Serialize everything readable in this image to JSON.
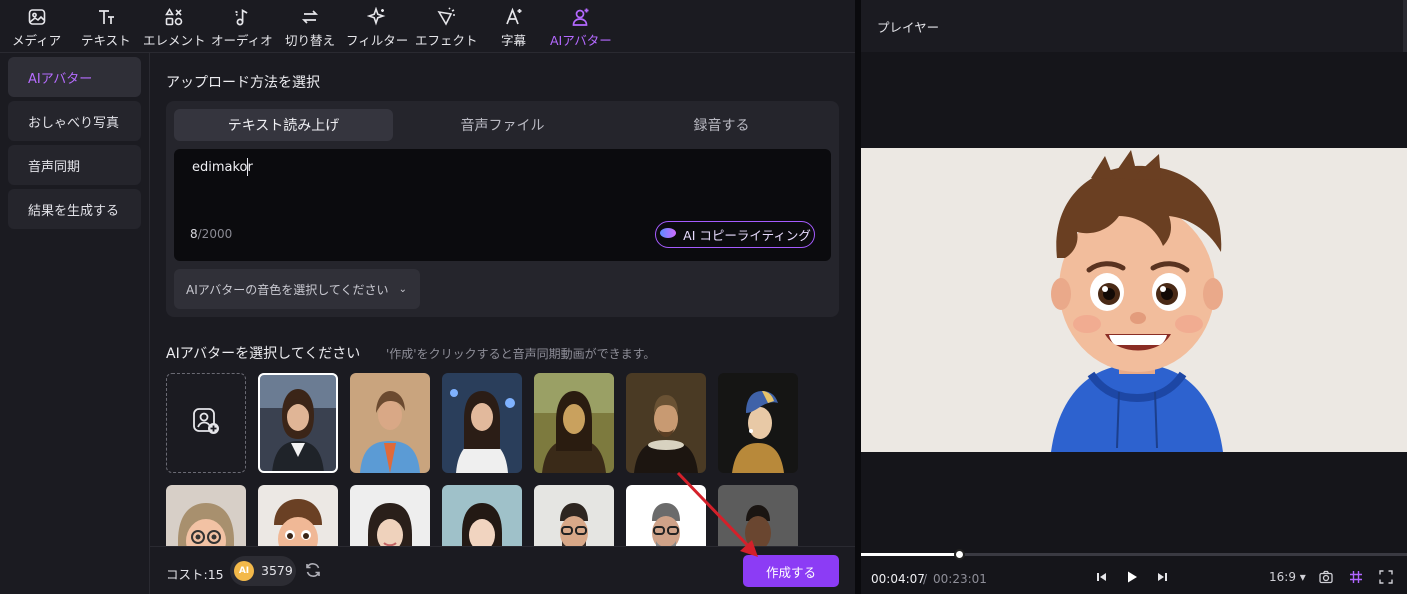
{
  "toolbar": {
    "items": [
      {
        "label": "メディア",
        "icon": "media-icon"
      },
      {
        "label": "テキスト",
        "icon": "text-icon"
      },
      {
        "label": "エレメント",
        "icon": "element-icon"
      },
      {
        "label": "オーディオ",
        "icon": "audio-icon"
      },
      {
        "label": "切り替え",
        "icon": "transition-icon"
      },
      {
        "label": "フィルター",
        "icon": "filter-icon"
      },
      {
        "label": "エフェクト",
        "icon": "effect-icon"
      },
      {
        "label": "字幕",
        "icon": "subtitle-icon"
      },
      {
        "label": "AIアバター",
        "icon": "ai-avatar-icon",
        "active": true
      }
    ]
  },
  "sidebar": {
    "items": [
      {
        "label": "AIアバター",
        "active": true
      },
      {
        "label": "おしゃべり写真"
      },
      {
        "label": "音声同期"
      },
      {
        "label": "結果を生成する"
      }
    ]
  },
  "upload": {
    "title": "アップロード方法を選択",
    "tabs": [
      {
        "label": "テキスト読み上げ",
        "active": true
      },
      {
        "label": "音声ファイル"
      },
      {
        "label": "録音する"
      }
    ],
    "text_value": "edimakor",
    "char_current": "8",
    "char_max": "/2000",
    "ai_copy_label": "AI コピーライティング",
    "voice_select_label": "AIアバターの音色を選択してください"
  },
  "avatars": {
    "heading": "AIアバターを選択してください",
    "hint": "'作成'をクリックすると音声同期動画ができます。",
    "items": [
      {
        "name": "woman-news-anchor",
        "selected": true
      },
      {
        "name": "woman-short-hair-blue-blazer"
      },
      {
        "name": "woman-long-hair-city"
      },
      {
        "name": "mona-lisa-painting"
      },
      {
        "name": "shakespeare-portrait"
      },
      {
        "name": "girl-pearl-earring-painting"
      },
      {
        "name": "cartoon-woman-glasses"
      },
      {
        "name": "cartoon-boy"
      },
      {
        "name": "asian-woman-white-bg"
      },
      {
        "name": "asian-woman-blue-bg"
      },
      {
        "name": "man-glasses-beard"
      },
      {
        "name": "man-glasses-suit"
      },
      {
        "name": "man-dark-suit"
      }
    ]
  },
  "footer": {
    "cost_label": "コスト:15",
    "credit_coin": "AI",
    "credits": "3579",
    "create_label": "作成する"
  },
  "player": {
    "title": "プレイヤー",
    "time_current": "00:04:07",
    "time_separator": "/",
    "time_total": "00:23:01",
    "progress": 0.18,
    "ratio_label": "16:9 ▾"
  },
  "colors": {
    "accent": "#8c3cf5",
    "accent_text": "#b66cff",
    "annotation_arrow": "#d4202a"
  }
}
